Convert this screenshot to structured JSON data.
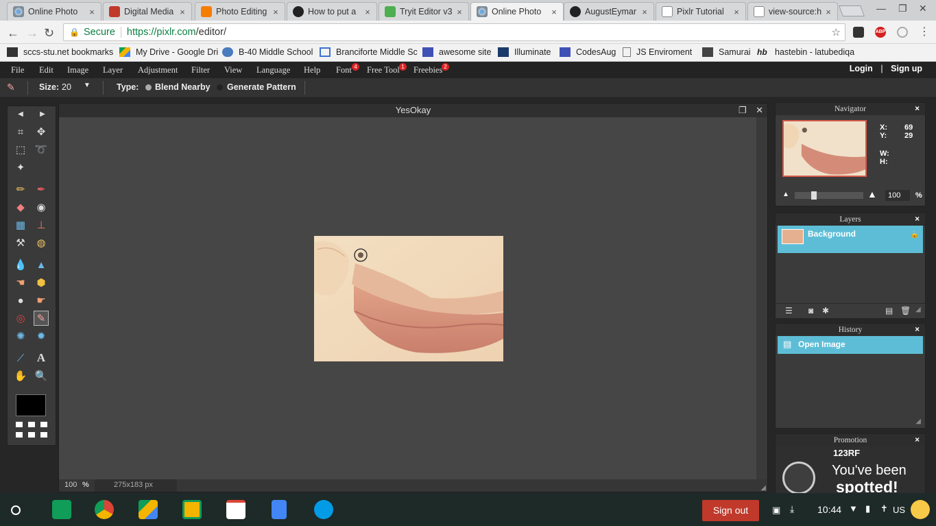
{
  "browser": {
    "tabs": [
      {
        "title": "Online Photo",
        "active": false
      },
      {
        "title": "Digital Media",
        "active": false
      },
      {
        "title": "Photo Editing",
        "active": false
      },
      {
        "title": "How to put a",
        "active": false
      },
      {
        "title": "Tryit Editor v3",
        "active": false
      },
      {
        "title": "Online Photo",
        "active": true
      },
      {
        "title": "AugustEymar",
        "active": false
      },
      {
        "title": "Pixlr Tutorial",
        "active": false
      },
      {
        "title": "view-source:h",
        "active": false
      }
    ],
    "close_glyph": "×",
    "secure_label": "Secure",
    "url_host": "https://pixlr.com",
    "url_path": "/editor/",
    "bookmarks": [
      "sccs-stu.net bookmarks",
      "My Drive - Google Dri",
      "B-40 Middle School",
      "Branciforte Middle Sc",
      "awesome site",
      "Illuminate",
      "CodesAug",
      "JS Enviroment",
      "Samurai",
      "hastebin - latubediqa"
    ],
    "abp_label": "ABP"
  },
  "menu": {
    "items": [
      "File",
      "Edit",
      "Image",
      "Layer",
      "Adjustment",
      "Filter",
      "View",
      "Language",
      "Help",
      "Font",
      "Free Tool",
      "Freebies"
    ],
    "badges": {
      "font": "4",
      "free_tool": "1",
      "freebies": "2"
    },
    "login": "Login",
    "divider": "|",
    "signup": "Sign up"
  },
  "options": {
    "size_label": "Size:",
    "size_value": "20",
    "type_label": "Type:",
    "type_options": [
      "Blend Nearby",
      "Generate Pattern"
    ],
    "selected_type": "Blend Nearby"
  },
  "document": {
    "title": "YesOkay",
    "zoom": "100",
    "zoom_unit": "%",
    "dimensions": "275x183 px"
  },
  "navigator": {
    "title": "Navigator",
    "x_label": "X:",
    "x_value": "69",
    "y_label": "Y:",
    "y_value": "29",
    "w_label": "W:",
    "h_label": "H:",
    "zoom": "100",
    "zoom_unit": "%"
  },
  "layers": {
    "title": "Layers",
    "items": [
      {
        "name": "Background",
        "locked": true
      }
    ]
  },
  "history": {
    "title": "History",
    "items": [
      "Open Image"
    ]
  },
  "promotion": {
    "title": "Promotion",
    "brand": "123RF",
    "line1": "You've been",
    "line2": "spotted!"
  },
  "shelf": {
    "signout": "Sign out",
    "time": "10:44",
    "locale": "US"
  },
  "colors": {
    "accent": "#5ebdd6",
    "signout": "#c0392b",
    "badge": "#dd2222",
    "secure": "#0b8043"
  }
}
